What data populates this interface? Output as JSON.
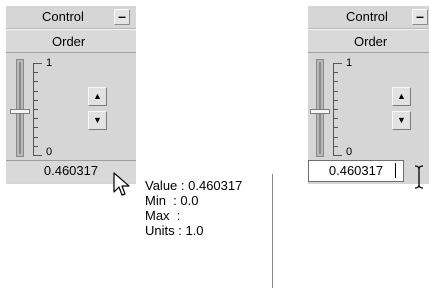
{
  "panels": [
    {
      "title": "Control",
      "minimize_glyph": "–",
      "order_label": "Order",
      "scale_max": "1",
      "scale_min": "0",
      "value": "0.460317",
      "value_mode": "display"
    },
    {
      "title": "Control",
      "minimize_glyph": "–",
      "order_label": "Order",
      "scale_max": "1",
      "scale_min": "0",
      "value": "0.460317",
      "value_mode": "editing"
    }
  ],
  "spin_up_icon": "triangle-up-icon",
  "spin_down_icon": "triangle-down-icon",
  "tooltip": {
    "lines": [
      "Value : 0.460317",
      "Min  : 0.0",
      "Max  :",
      "Units : 1.0"
    ]
  },
  "cursors": {
    "left": "arrow-pointer-icon",
    "right": "text-ibeam-icon"
  },
  "colors": {
    "panel_bg": "#d6d6d6",
    "edit_bg": "#ffffff",
    "tooltip_bg": "#ffffff"
  }
}
